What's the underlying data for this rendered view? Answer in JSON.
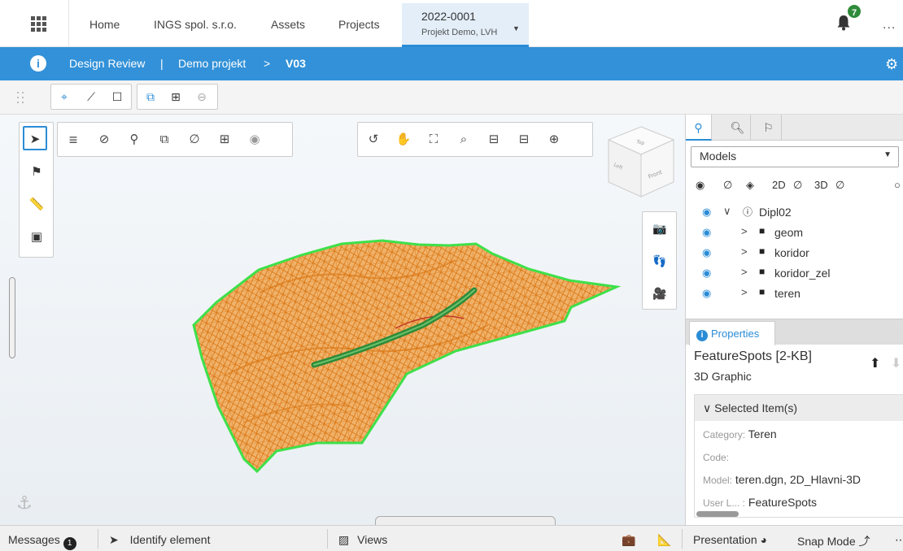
{
  "topnav": {
    "items": [
      "Home",
      "INGS spol. s.r.o.",
      "Assets",
      "Projects"
    ],
    "project_id": "2022-0001",
    "project_name": "Projekt Demo, LVH",
    "notification_count": "7",
    "more": "..."
  },
  "header": {
    "app_title": "Design Review",
    "separator": "|",
    "project": "Demo projekt",
    "arrow": ">",
    "version": "V03"
  },
  "panel": {
    "models_select": "Models",
    "vis_2d": "2D",
    "vis_3d": "3D",
    "tree": [
      {
        "label": "Dipl02",
        "level": 0
      },
      {
        "label": "geom",
        "level": 1
      },
      {
        "label": "koridor",
        "level": 1
      },
      {
        "label": "koridor_zel",
        "level": 1
      },
      {
        "label": "teren",
        "level": 1
      }
    ],
    "properties_tab": "Properties",
    "feature_title": "FeatureSpots [2-KB]",
    "feature_subtitle": "3D Graphic",
    "selected_header": "Selected Item(s)",
    "props": [
      {
        "key": "Category:",
        "value": "Teren"
      },
      {
        "key": "Code:",
        "value": ""
      },
      {
        "key": "Model:",
        "value": "teren.dgn, 2D_Hlavni-3D"
      },
      {
        "key": "User L... :",
        "value": "FeatureSpots"
      }
    ]
  },
  "cube": {
    "top": "Top",
    "front": "Front",
    "left": "Left"
  },
  "status": {
    "messages": "Messages",
    "messages_count": "1",
    "identify": "Identify element",
    "views": "Views",
    "presentation": "Presentation",
    "snap": "Snap Mode"
  },
  "colors": {
    "accent": "#3291d8",
    "mesh": "#e8861a",
    "boundary": "#38d84a",
    "road": "#2e8b3a"
  }
}
